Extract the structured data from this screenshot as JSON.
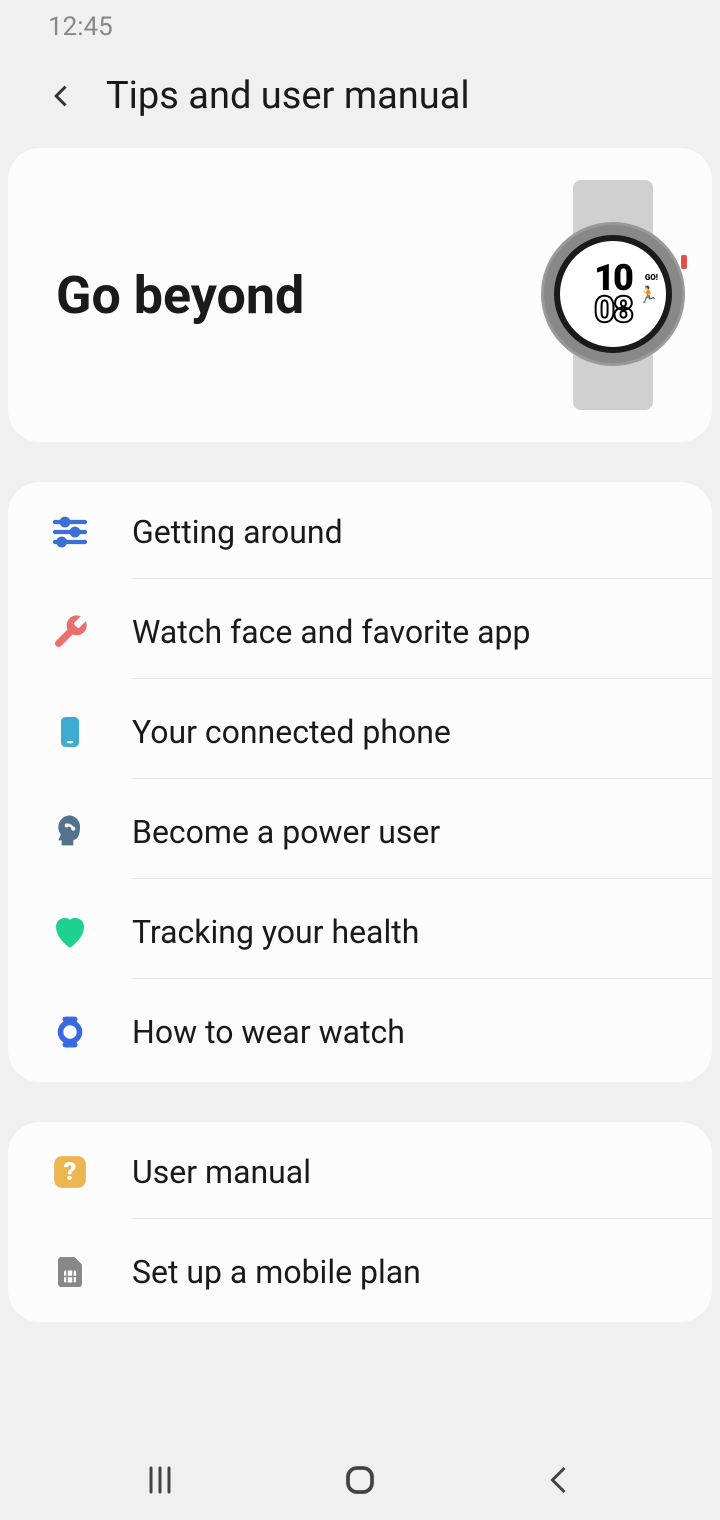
{
  "status": {
    "time": "12:45"
  },
  "header": {
    "title": "Tips and user manual"
  },
  "hero": {
    "title": "Go beyond",
    "watch_time_top": "10",
    "watch_time_bottom": "08",
    "watch_go": "GO!"
  },
  "sections": [
    {
      "items": [
        {
          "label": "Getting around",
          "icon": "sliders",
          "color": "#3b6fd6"
        },
        {
          "label": "Watch face and favorite app",
          "icon": "wrench",
          "color": "#e8726b"
        },
        {
          "label": "Your connected phone",
          "icon": "phone",
          "color": "#3eacd1"
        },
        {
          "label": "Become a power user",
          "icon": "head",
          "color": "#53738c"
        },
        {
          "label": "Tracking your health",
          "icon": "heart",
          "color": "#1fd190"
        },
        {
          "label": "How to wear watch",
          "icon": "watch",
          "color": "#3869e0"
        }
      ]
    },
    {
      "items": [
        {
          "label": "User manual",
          "icon": "help",
          "color": "#edb550"
        },
        {
          "label": "Set up a mobile plan",
          "icon": "sim",
          "color": "#888888"
        }
      ]
    }
  ]
}
